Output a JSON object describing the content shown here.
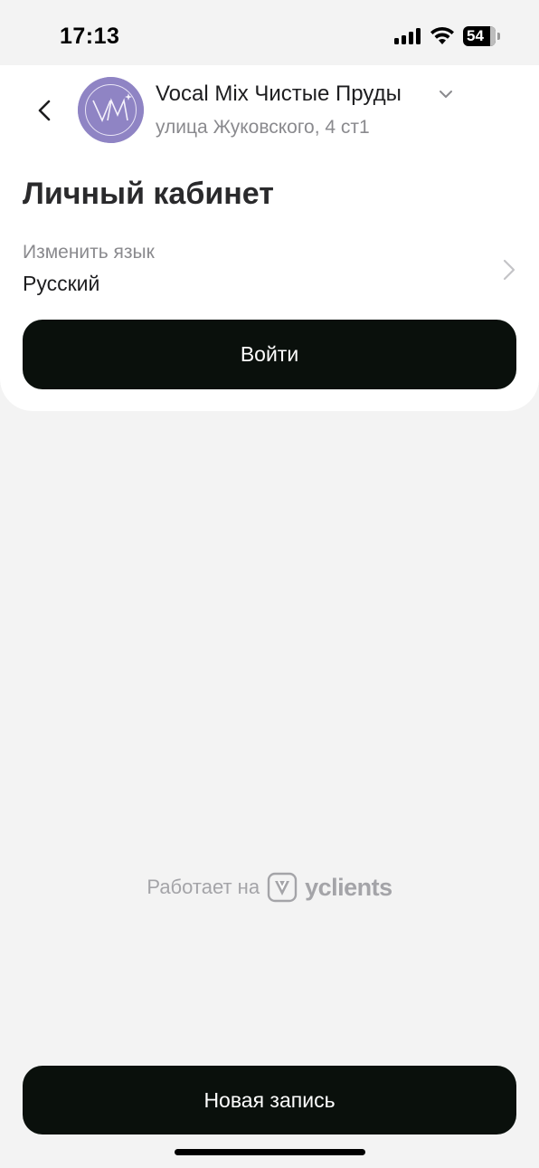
{
  "status_bar": {
    "time": "17:13",
    "battery": "54"
  },
  "header": {
    "logo_monogram": "VM",
    "salon_name": "Vocal Mix Чистые Пруды",
    "address": "улица Жуковского, 4 ст1",
    "back_icon": "chevron-left-icon",
    "dropdown_icon": "chevron-down-icon"
  },
  "page": {
    "title": "Личный кабинет"
  },
  "language": {
    "label": "Изменить язык",
    "value": "Русский"
  },
  "actions": {
    "login_label": "Войти",
    "new_booking_label": "Новая запись"
  },
  "footer": {
    "powered_by": "Работает на",
    "brand": "yclients"
  },
  "colors": {
    "background": "#f3f3f3",
    "card": "#ffffff",
    "button": "#0a100c",
    "avatar": "#8f84c4",
    "muted_text": "#8a8a8e"
  }
}
